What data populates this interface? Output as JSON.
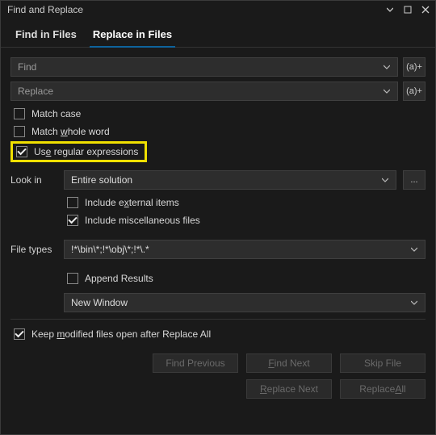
{
  "window": {
    "title": "Find and Replace"
  },
  "tabs": {
    "find_in_files": "Find in Files",
    "replace_in_files": "Replace in Files"
  },
  "inputs": {
    "find_placeholder": "Find",
    "replace_placeholder": "Replace",
    "regex_btn": "(a)+"
  },
  "options": {
    "match_case": "Match case",
    "match_whole_word_prefix": "Match ",
    "match_whole_word_u": "w",
    "match_whole_word_suffix": "hole word",
    "use_regex_prefix": "Us",
    "use_regex_u": "e",
    "use_regex_suffix": " regular expressions"
  },
  "lookin": {
    "label": "Look in",
    "value": "Entire solution",
    "browse": "...",
    "include_external_prefix": "Include e",
    "include_external_u": "x",
    "include_external_suffix": "ternal items",
    "include_misc": "Include miscellaneous files"
  },
  "filetypes": {
    "label": "File types",
    "value": "!*\\bin\\*;!*\\obj\\*;!*\\.*"
  },
  "results": {
    "append": "Append Results",
    "window": "New Window"
  },
  "keep_modified_prefix": "Keep ",
  "keep_modified_u": "m",
  "keep_modified_suffix": "odified files open after Replace All",
  "buttons": {
    "find_previous": "Find Previous",
    "find_next_prefix": "",
    "find_next_u": "F",
    "find_next_suffix": "ind Next",
    "skip_file": "Skip File",
    "replace_next_prefix": "",
    "replace_next_u": "R",
    "replace_next_suffix": "eplace Next",
    "replace_all_prefix": "Replace ",
    "replace_all_u": "A",
    "replace_all_suffix": "ll"
  }
}
